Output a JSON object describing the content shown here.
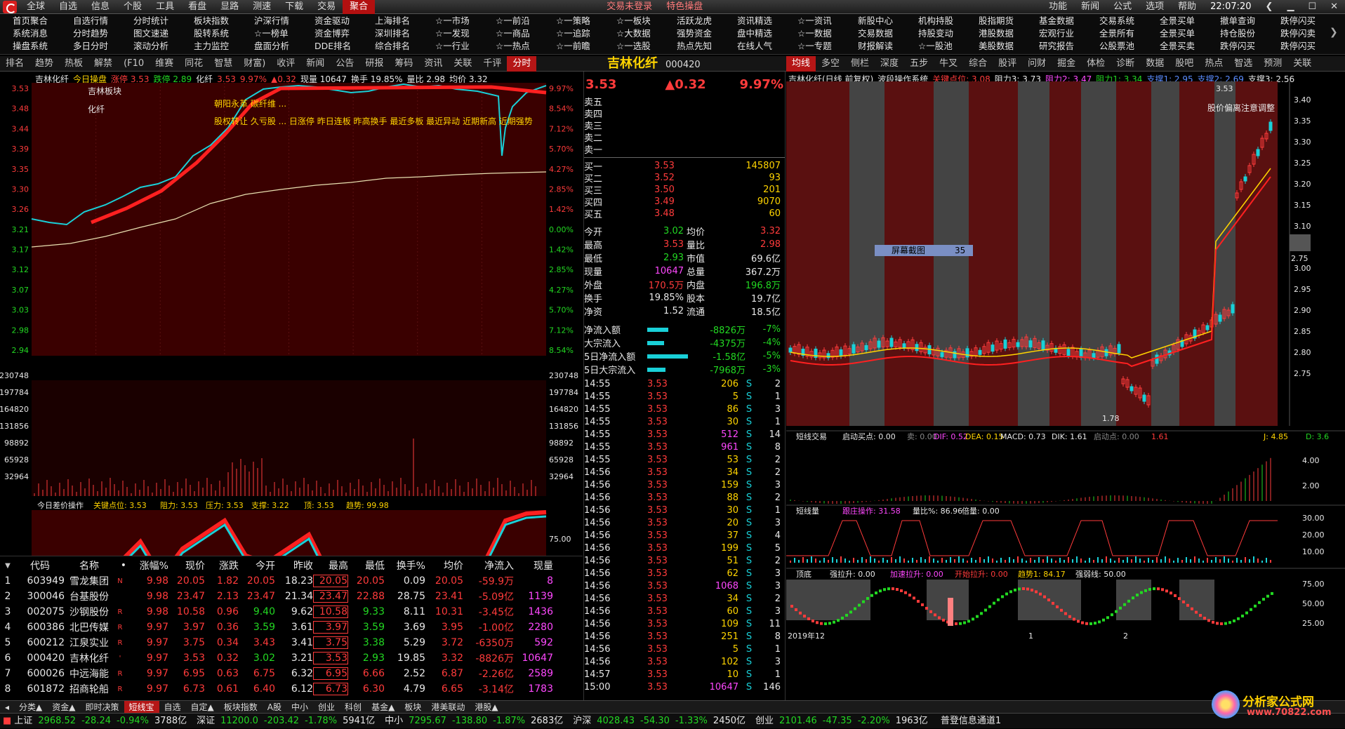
{
  "menubar": {
    "items": [
      "全球",
      "自选",
      "信息",
      "个股",
      "工具",
      "看盘",
      "显路",
      "测速",
      "下载",
      "交易",
      "聚合"
    ],
    "active": "聚合",
    "notice1": "交易未登录",
    "notice2": "特色操盘",
    "right": [
      "功能",
      "新闻",
      "公式",
      "选项",
      "帮助"
    ],
    "clock": "22:07:20"
  },
  "shortcuts": [
    [
      "首页聚合",
      "系统消息",
      "操盘系统"
    ],
    [
      "自选行情",
      "分时趋势",
      "多日分时"
    ],
    [
      "分时统计",
      "图文速递",
      "滚动分析"
    ],
    [
      "板块指数",
      "股转系统",
      "主力监控"
    ],
    [
      "沪深行情",
      "☆一榜单",
      "盘面分析"
    ],
    [
      "资金驱动",
      "资金博弈",
      "DDE排名"
    ],
    [
      "上海排名",
      "深圳排名",
      "综合排名"
    ],
    [
      "☆一市场",
      "☆一发现",
      "☆一行业"
    ],
    [
      "☆一前沿",
      "☆一商品",
      "☆一热点"
    ],
    [
      "☆一策略",
      "☆一追踪",
      "☆一前瞻"
    ],
    [
      "☆一板块",
      "☆大数据",
      "☆一选股"
    ],
    [
      "活跃龙虎",
      "强势资金",
      "热点先知"
    ],
    [
      "资讯精选",
      "盘中精选",
      "在线人气"
    ],
    [
      "☆一资讯",
      "☆一数据",
      "☆一专题"
    ],
    [
      "新股中心",
      "交易数据",
      "财报解读"
    ],
    [
      "机构持股",
      "持股变动",
      "☆一股池"
    ],
    [
      "股指期货",
      "港股数据",
      "美股数据"
    ],
    [
      "基金数据",
      "宏观行业",
      "研究报告"
    ],
    [
      "交易系统",
      "全景所有",
      "公股票池"
    ],
    [
      "全景买单",
      "全景买单",
      "全景买卖"
    ],
    [
      "撤单查询",
      "持仓股份",
      "跌停闪买"
    ],
    [
      "跌停闪买",
      "跌停闪卖",
      "跌停闪买"
    ]
  ],
  "tabs": [
    "排名",
    "趋势",
    "热板",
    "解禁",
    "(F10",
    "维赛",
    "同花",
    "智慧",
    "财富)",
    "收评",
    "新闻",
    "公告",
    "研报",
    "筹码",
    "资讯",
    "关联",
    "千评",
    "分时"
  ],
  "tabs_active": "分时",
  "tabs_right": [
    "均线",
    "多空",
    "侧栏",
    "深度",
    "五步",
    "牛叉",
    "综合",
    "股评",
    "问财",
    "掘金",
    "体检",
    "诊断",
    "数据",
    "股吧",
    "热点",
    "智选",
    "预测",
    "关联"
  ],
  "tabs_right_active": "均线",
  "intraday": {
    "header": [
      "吉林化纤",
      "今日操盘",
      "涨停 3.53",
      "跌停 2.89",
      "化纤",
      "3.53",
      "9.97%",
      "▲0.32",
      "现量 10647",
      "换手 19.85%",
      "量比 2.98",
      "均价 3.32"
    ],
    "board_label": "吉林板块",
    "sector": "化纤",
    "note1": "朝阳永革 碳纤维 ...",
    "note2": "股权转让 久亏股 ... 日涨停 昨日连板 昨高换手 最近多板 最近异动 近期新高 近期强势",
    "price_ticks": [
      "3.53",
      "3.48",
      "3.44",
      "3.39",
      "3.35",
      "3.30",
      "3.26",
      "3.21",
      "3.17",
      "3.12",
      "3.07",
      "3.03",
      "2.98",
      "2.94"
    ],
    "pct_ticks": [
      "9.97%",
      "8.54%",
      "7.12%",
      "5.70%",
      "4.27%",
      "2.85%",
      "1.42%",
      "0.00%",
      "1.42%",
      "2.85%",
      "4.27%",
      "5.70%",
      "7.12%",
      "8.54%"
    ],
    "vol_ticks": [
      "230748",
      "197784",
      "164820",
      "131856",
      "98892",
      "65928",
      "32964"
    ],
    "osc_header": [
      "今日差价操作",
      "关键点位: 3.53",
      "阻力: 3.53",
      "压力: 3.53",
      "支撑: 3.22",
      "顶: 3.53",
      "趋势: 99.98"
    ],
    "osc_ticks": [
      "75.00",
      "50.00",
      "25.00",
      "0.00"
    ],
    "time_ticks": [
      "09:30",
      "10:30",
      "13:00",
      "14:00",
      "15:00"
    ],
    "tags": [
      "涨停",
      "涨停",
      "涨停",
      "涨停",
      "涨停",
      "涨停",
      "涨停",
      "涨停"
    ]
  },
  "watch": {
    "columns": [
      "代码",
      "名称",
      "•",
      "涨幅%",
      "现价",
      "涨跌",
      "今开",
      "昨收",
      "最高",
      "最低",
      "换手%",
      "均价",
      "净流入",
      "现量"
    ],
    "rows": [
      [
        "1",
        "603949",
        "雪龙集团",
        "N",
        "9.98",
        "20.05",
        "1.82",
        "20.05",
        "18.23",
        "20.05",
        "20.05",
        "0.09",
        "20.05",
        "-59.9万",
        "8"
      ],
      [
        "2",
        "300046",
        "台基股份",
        "",
        "9.98",
        "23.47",
        "2.13",
        "23.47",
        "21.34",
        "23.47",
        "22.88",
        "28.75",
        "23.41",
        "-5.09亿",
        "1139"
      ],
      [
        "3",
        "002075",
        "沙钢股份",
        "R",
        "9.98",
        "10.58",
        "0.96",
        "9.40",
        "9.62",
        "10.58",
        "9.33",
        "8.11",
        "10.31",
        "-3.45亿",
        "1436"
      ],
      [
        "4",
        "600386",
        "北巴传媒",
        "R",
        "9.97",
        "3.97",
        "0.36",
        "3.59",
        "3.61",
        "3.97",
        "3.59",
        "3.69",
        "3.95",
        "-1.00亿",
        "2280"
      ],
      [
        "5",
        "600212",
        "江泉实业",
        "R",
        "9.97",
        "3.75",
        "0.34",
        "3.43",
        "3.41",
        "3.75",
        "3.38",
        "5.29",
        "3.72",
        "-6350万",
        "592"
      ],
      [
        "6",
        "000420",
        "吉林化纤",
        "'",
        "9.97",
        "3.53",
        "0.32",
        "3.02",
        "3.21",
        "3.53",
        "2.93",
        "19.85",
        "3.32",
        "-8826万",
        "10647"
      ],
      [
        "7",
        "600026",
        "中远海能",
        "R",
        "9.97",
        "6.95",
        "0.63",
        "6.75",
        "6.32",
        "6.95",
        "6.66",
        "2.52",
        "6.87",
        "-2.26亿",
        "2589"
      ],
      [
        "8",
        "601872",
        "招商轮船",
        "R",
        "9.97",
        "6.73",
        "0.61",
        "6.40",
        "6.12",
        "6.73",
        "6.30",
        "4.79",
        "6.65",
        "-3.14亿",
        "1783"
      ]
    ]
  },
  "quote": {
    "name": "吉林化纤",
    "code": "000420",
    "price": "3.53",
    "change": "▲0.32",
    "pct": "9.97%",
    "sell": [
      "卖五",
      "卖四",
      "卖三",
      "卖二",
      "卖一"
    ],
    "buy": [
      [
        "买一",
        "3.53",
        "145807"
      ],
      [
        "买二",
        "3.52",
        "93"
      ],
      [
        "买三",
        "3.50",
        "201"
      ],
      [
        "买四",
        "3.49",
        "9070"
      ],
      [
        "买五",
        "3.48",
        "60"
      ]
    ],
    "stats": [
      [
        "今开",
        "3.02",
        "均价",
        "3.32"
      ],
      [
        "最高",
        "3.53",
        "量比",
        "2.98"
      ],
      [
        "最低",
        "2.93",
        "市值",
        "69.6亿"
      ],
      [
        "现量",
        "10647",
        "总量",
        "367.2万"
      ],
      [
        "外盘",
        "170.5万",
        "内盘",
        "196.8万"
      ],
      [
        "换手",
        "19.85%",
        "股本",
        "19.7亿"
      ],
      [
        "净资",
        "1.52",
        "流通",
        "18.5亿"
      ]
    ],
    "flows": [
      [
        "净流入额",
        "-8826万",
        "-7%"
      ],
      [
        "大宗流入",
        "-4375万",
        "-4%"
      ],
      [
        "5日净流入额",
        "-1.58亿",
        "-5%"
      ],
      [
        "5日大宗流入",
        "-7968万",
        "-3%"
      ]
    ],
    "ticks": [
      [
        "14:55",
        "3.53",
        "206",
        "S",
        "2"
      ],
      [
        "14:55",
        "3.53",
        "5",
        "S",
        "1"
      ],
      [
        "14:55",
        "3.53",
        "86",
        "S",
        "3"
      ],
      [
        "14:55",
        "3.53",
        "30",
        "S",
        "1"
      ],
      [
        "14:55",
        "3.53",
        "512",
        "S",
        "14"
      ],
      [
        "14:55",
        "3.53",
        "961",
        "S",
        "8"
      ],
      [
        "14:55",
        "3.53",
        "53",
        "S",
        "2"
      ],
      [
        "14:56",
        "3.53",
        "34",
        "S",
        "2"
      ],
      [
        "14:56",
        "3.53",
        "159",
        "S",
        "3"
      ],
      [
        "14:56",
        "3.53",
        "88",
        "S",
        "2"
      ],
      [
        "14:56",
        "3.53",
        "30",
        "S",
        "1"
      ],
      [
        "14:56",
        "3.53",
        "20",
        "S",
        "3"
      ],
      [
        "14:56",
        "3.53",
        "37",
        "S",
        "4"
      ],
      [
        "14:56",
        "3.53",
        "199",
        "S",
        "5"
      ],
      [
        "14:56",
        "3.53",
        "51",
        "S",
        "2"
      ],
      [
        "14:56",
        "3.53",
        "62",
        "S",
        "3"
      ],
      [
        "14:56",
        "3.53",
        "1068",
        "S",
        "3"
      ],
      [
        "14:56",
        "3.53",
        "34",
        "S",
        "2"
      ],
      [
        "14:56",
        "3.53",
        "60",
        "S",
        "3"
      ],
      [
        "14:56",
        "3.53",
        "109",
        "S",
        "11"
      ],
      [
        "14:56",
        "3.53",
        "251",
        "S",
        "8"
      ],
      [
        "14:56",
        "3.53",
        "5",
        "S",
        "1"
      ],
      [
        "14:56",
        "3.53",
        "102",
        "S",
        "3"
      ],
      [
        "14:57",
        "3.53",
        "10",
        "S",
        "1"
      ],
      [
        "15:00",
        "3.53",
        "10647",
        "S",
        "146"
      ]
    ],
    "tabs": [
      "笔",
      "值",
      "风",
      "龙",
      "主",
      "雷",
      "播"
    ]
  },
  "kline": {
    "header": [
      "吉林化纤(日线 前复权)",
      "波段操作系统",
      "关键点位: 3.08",
      "阻力3: 3.73",
      "阻力2: 3.47",
      "阻力1: 3.34",
      "支撑1: 2.95",
      "支撑2: 2.69",
      "支撑3: 2.56"
    ],
    "annot": "股价偏离注意调整",
    "ticks": [
      "3.40",
      "3.35",
      "3.30",
      "3.25",
      "3.20",
      "3.15",
      "3.10",
      "3.05",
      "3.00",
      "2.95",
      "2.90",
      "2.85",
      "2.80",
      "2.75"
    ],
    "price_tag": "2.75",
    "high_tag": "3.53",
    "low_tag": "1.78",
    "popup": [
      "屏幕截图",
      "35"
    ],
    "macd_header": [
      "短线交易",
      "启动买点: 0.00",
      "卖: 0.00",
      "DIF: 0.52",
      "DEA: 0.15",
      "MACD: 0.73",
      "DIK: 1.61",
      "启动点: 0.00",
      "1.61",
      "J: 4.85",
      "D: 3.6"
    ],
    "macd_ticks": [
      "4.00",
      "2.00"
    ],
    "vol_header": [
      "短线量",
      "跟庄操作: 31.58",
      "量比%: 86.96",
      "倍量: 0.00"
    ],
    "vol_ticks": [
      "30.00",
      "20.00",
      "10.00"
    ],
    "top_header": [
      "顶底",
      "强拉升: 0.00",
      "加速拉升: 0.00",
      "开始拉升: 0.00",
      "趋势1: 84.17",
      "强弱线: 50.00"
    ],
    "top_ticks": [
      "75.00",
      "50.00",
      "25.00"
    ],
    "date_ticks": [
      "2019年12",
      "1",
      "2"
    ],
    "bottom_tabs": [
      "指标",
      "模板",
      "管理",
      "另存为",
      "绑定到",
      "基本",
      "操盘",
      "短线",
      "决策",
      "趋势",
      "波段"
    ]
  },
  "bottom_tabs": [
    "分类▲",
    "资金▲",
    "即时决策",
    "短线宝",
    "自选",
    "自定▲",
    "板块指数",
    "A股",
    "中小",
    "创业",
    "科创",
    "基金▲",
    "板块",
    "港美联动",
    "港股▲"
  ],
  "status": [
    [
      "上证",
      "2968.52",
      "-28.24",
      "-0.94%",
      "3788亿"
    ],
    [
      "深证",
      "11200.0",
      "-203.42",
      "-1.78%",
      "5941亿"
    ],
    [
      "中小",
      "7295.67",
      "-138.80",
      "-1.87%",
      "2683亿"
    ],
    [
      "沪深",
      "4028.43",
      "-54.30",
      "-1.33%",
      "2450亿"
    ],
    [
      "创业",
      "2101.46",
      "-47.35",
      "-2.20%",
      "1963亿"
    ]
  ],
  "status_msg": "普登信息通道1",
  "watermark": {
    "brand": "分析家公式网",
    "url": "www.70822.com"
  },
  "colors": {
    "up": "#ff3b3b",
    "down": "#22d822",
    "accent": "#b51616",
    "cyan": "#19d0d8",
    "yellow": "#ffd400"
  }
}
